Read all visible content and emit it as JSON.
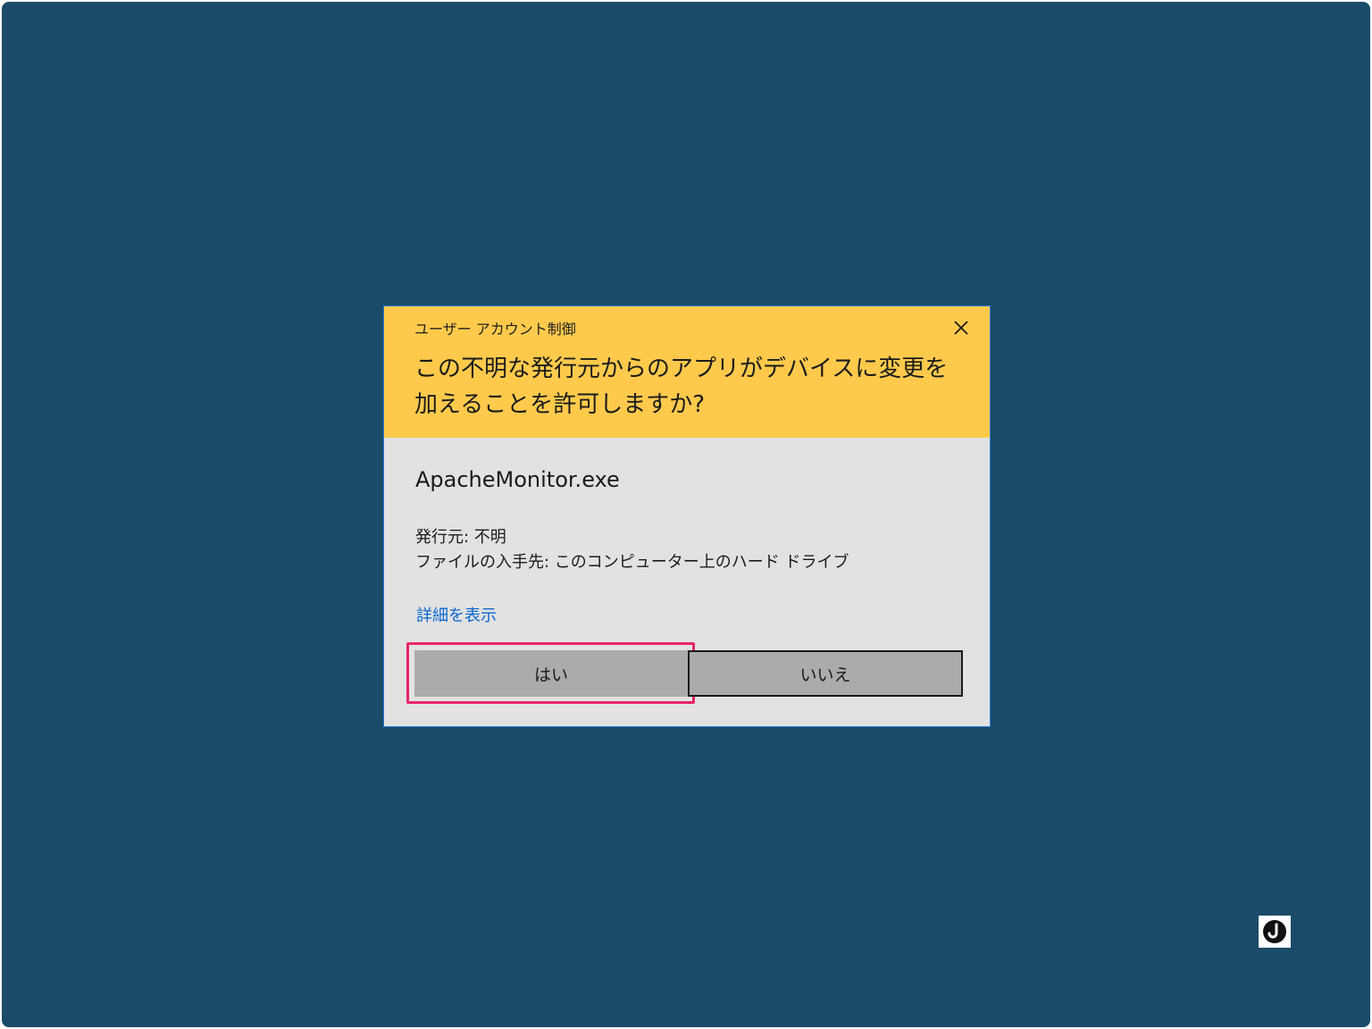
{
  "uac_dialog": {
    "caption": "ユーザー アカウント制御",
    "question_line1": "この不明な発行元からのアプリがデバイスに変更を",
    "question_line2": "加えることを許可しますか?",
    "app_name": "ApacheMonitor.exe",
    "publisher": "発行元: 不明",
    "file_origin": "ファイルの入手先: このコンピューター上のハード ドライブ",
    "details_link": "詳細を表示",
    "yes_label": "はい",
    "no_label": "いいえ",
    "close_icon": "close-icon"
  },
  "tray": {
    "icon": "moon-icon"
  },
  "colors": {
    "desktop_background": "#1a4b69",
    "header_background": "#ffca4c",
    "dialog_body": "#e2e2e2",
    "button": "#ababab",
    "link": "#0b66d0",
    "highlight": "#e8246b",
    "dialog_border": "#2b79d8"
  }
}
